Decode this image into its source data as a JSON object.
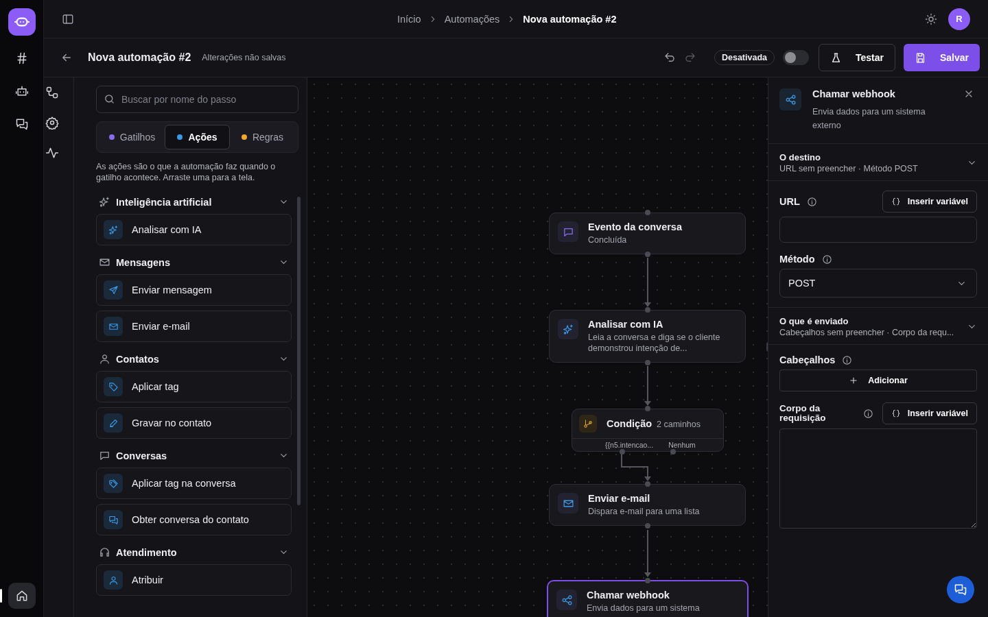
{
  "rail": {
    "items": [
      {
        "kind": "channels",
        "selected": false
      },
      {
        "kind": "bots",
        "selected": false
      },
      {
        "kind": "chats",
        "selected": false
      }
    ],
    "home": {
      "kind": "home",
      "selected": true
    }
  },
  "header": {
    "breadcrumb": [
      {
        "label": "Início",
        "current": false
      },
      {
        "label": "Automações",
        "current": false
      },
      {
        "label": "Nova automação #2",
        "current": true
      }
    ],
    "avatar": "R"
  },
  "toolbar": {
    "title": "Nova automação #2",
    "status": "Alterações não salvas",
    "toggle": {
      "label": "Desativada",
      "on": false
    },
    "test_button": "Testar",
    "save_button": "Salvar"
  },
  "palette": {
    "search": {
      "placeholder": "Buscar por nome do passo"
    },
    "tabs": [
      {
        "label": "Gatilhos",
        "color": "#8b6cf0",
        "selected": false
      },
      {
        "label": "Ações",
        "color": "#3a9ae8",
        "selected": true
      },
      {
        "label": "Regras",
        "color": "#f0a830",
        "selected": false
      }
    ],
    "description": "As ações são o que a automação faz quando o gatilho acontece. Arraste uma para a tela.",
    "groups": [
      {
        "title": "Inteligência artificial",
        "kind": "sparkles",
        "items": [
          {
            "label": "Analisar com IA",
            "kind": "sparkles"
          }
        ]
      },
      {
        "title": "Mensagens",
        "kind": "mail",
        "items": [
          {
            "label": "Enviar mensagem",
            "kind": "send"
          },
          {
            "label": "Enviar e-mail",
            "kind": "mail"
          }
        ]
      },
      {
        "title": "Contatos",
        "kind": "user",
        "items": [
          {
            "label": "Aplicar tag",
            "kind": "tag"
          },
          {
            "label": "Gravar no contato",
            "kind": "pen"
          }
        ]
      },
      {
        "title": "Conversas",
        "kind": "chat",
        "items": [
          {
            "label": "Aplicar tag na conversa",
            "kind": "tags"
          },
          {
            "label": "Obter conversa do contato",
            "kind": "chats"
          }
        ]
      },
      {
        "title": "Atendimento",
        "kind": "headset",
        "items": [
          {
            "label": "Atribuir",
            "kind": "user"
          }
        ]
      }
    ]
  },
  "canvas": {
    "nodes": [
      {
        "kind": "chat",
        "title": "Evento da conversa",
        "subtitle": "Concluída",
        "color": "#8b6cf0",
        "selected": false
      },
      {
        "kind": "sparkles",
        "title": "Analisar com IA",
        "subtitle": "Leia a conversa e diga se o cliente demonstrou intenção de...",
        "color": "#3a9ae8",
        "selected": false
      },
      {
        "kind": "branch",
        "title": "Condição",
        "count": "2 caminhos",
        "branches": [
          "{{n5.intencao...",
          "Nenhum"
        ],
        "color": "#e0a030",
        "selected": false
      },
      {
        "kind": "mail",
        "title": "Enviar e-mail",
        "subtitle": "Dispara e-mail para uma lista",
        "color": "#3a9ae8",
        "selected": false
      },
      {
        "kind": "share",
        "title": "Chamar webhook",
        "subtitle": "Envia dados para um sistema",
        "color": "#3a9ae8",
        "selected": true
      }
    ]
  },
  "inspector": {
    "title": "Chamar webhook",
    "description": "Envia dados para um sistema externo",
    "destination": {
      "title": "O destino",
      "summary": "URL sem preencher · Método POST"
    },
    "url": {
      "label": "URL",
      "button": "Inserir variável"
    },
    "method": {
      "label": "Método",
      "value": "POST"
    },
    "payload": {
      "title": "O que é enviado",
      "summary": "Cabeçalhos sem preencher · Corpo da requ..."
    },
    "headers": {
      "label": "Cabeçalhos",
      "button": "Adicionar"
    },
    "body": {
      "label": "Corpo da requisição",
      "button": "Inserir variável"
    }
  }
}
